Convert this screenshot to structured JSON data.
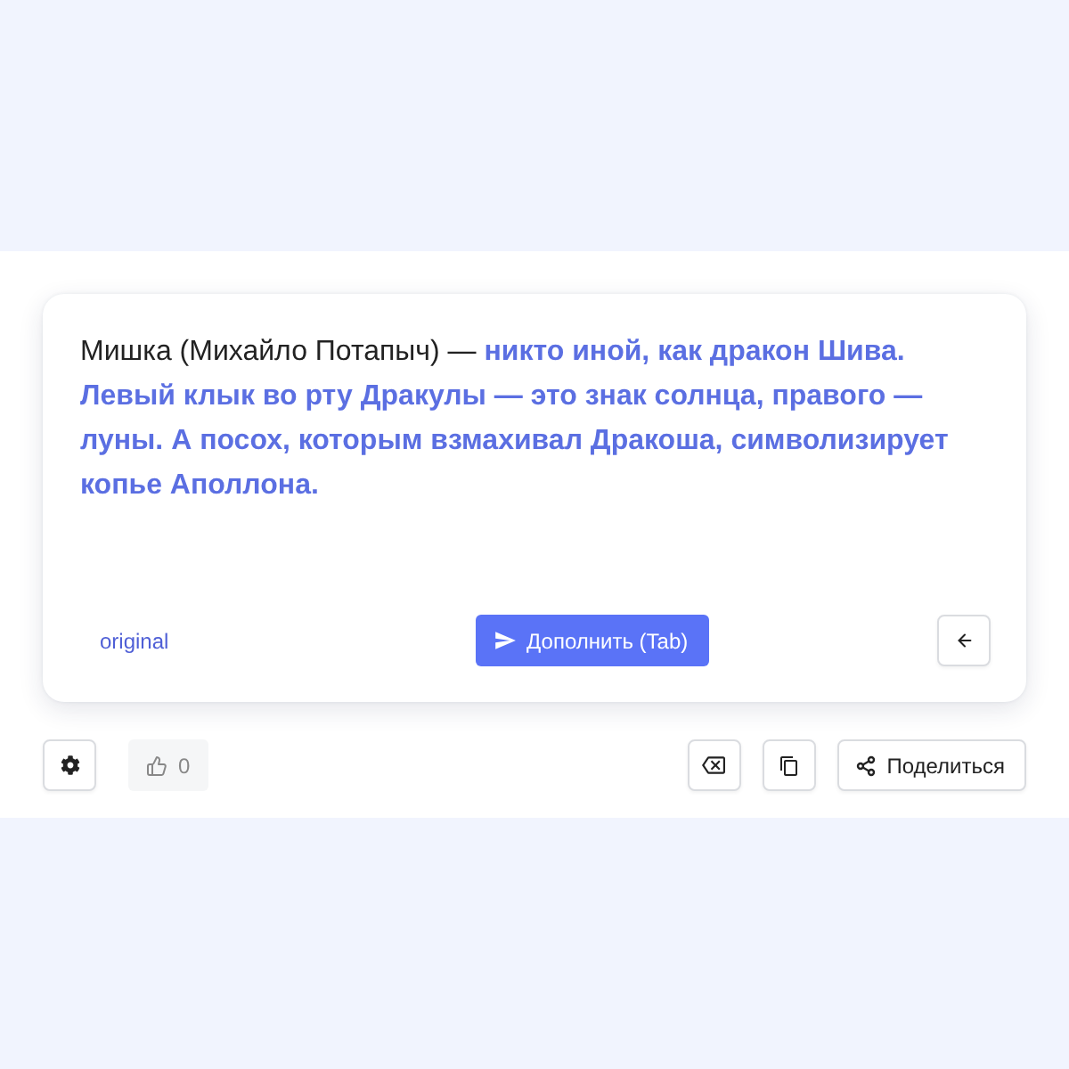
{
  "editor": {
    "text": "Мишка (Михайло Потапыч) — **никто иной, как дракон Шива. Левый клык во рту Дракулы — это знак солнца, правого — луны. А посох, которым взмахивал Дракоша, символизирует копье Аполлона.**"
  },
  "card_footer": {
    "link": "original",
    "continue_button": "Дополнить (Tab)"
  },
  "toolbar": {
    "likes": "0",
    "share_button": "Поделиться"
  }
}
